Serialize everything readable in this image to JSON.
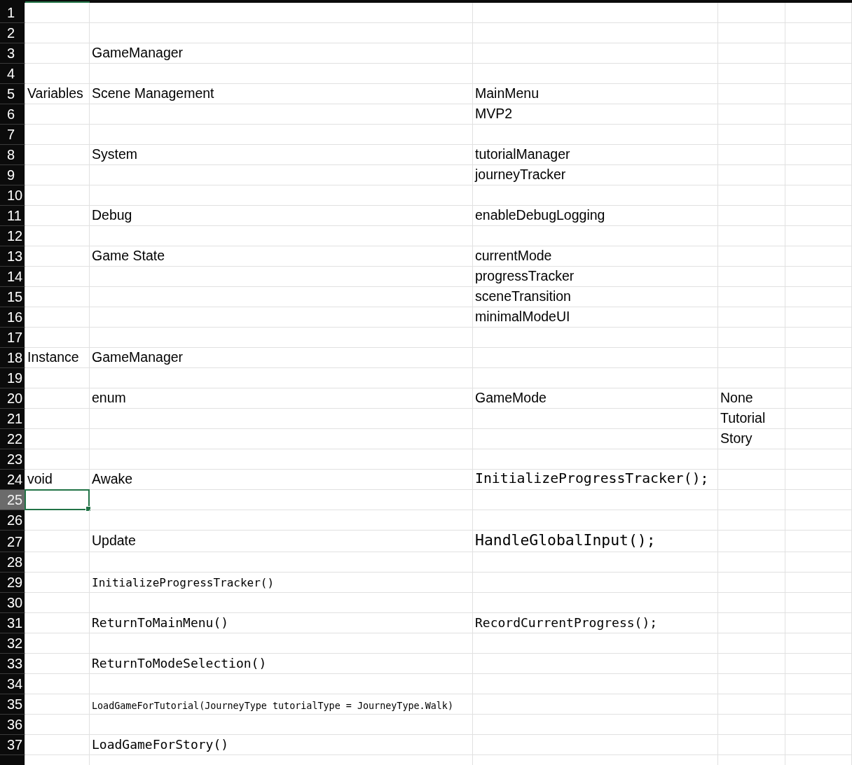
{
  "rows": [
    {
      "number": "1",
      "selected": false,
      "cells": [
        null,
        null,
        null,
        null,
        null
      ]
    },
    {
      "number": "2",
      "selected": false,
      "cells": [
        null,
        null,
        null,
        null,
        null
      ]
    },
    {
      "number": "3",
      "selected": false,
      "cells": [
        null,
        {
          "text": "GameManager",
          "kind": "text"
        },
        null,
        null,
        null
      ]
    },
    {
      "number": "4",
      "selected": false,
      "cells": [
        null,
        null,
        null,
        null,
        null
      ]
    },
    {
      "number": "5",
      "selected": false,
      "cells": [
        {
          "text": "Variables",
          "kind": "text"
        },
        {
          "text": "Scene Management",
          "kind": "text"
        },
        {
          "text": "MainMenu",
          "kind": "text"
        },
        null,
        null
      ]
    },
    {
      "number": "6",
      "selected": false,
      "cells": [
        null,
        null,
        {
          "text": "MVP2",
          "kind": "text"
        },
        null,
        null
      ]
    },
    {
      "number": "7",
      "selected": false,
      "cells": [
        null,
        null,
        null,
        null,
        null
      ]
    },
    {
      "number": "8",
      "selected": false,
      "cells": [
        null,
        {
          "text": "System",
          "kind": "text"
        },
        {
          "text": "tutorialManager",
          "kind": "text"
        },
        null,
        null
      ]
    },
    {
      "number": "9",
      "selected": false,
      "cells": [
        null,
        null,
        {
          "text": "journeyTracker",
          "kind": "text"
        },
        null,
        null
      ]
    },
    {
      "number": "10",
      "selected": false,
      "cells": [
        null,
        null,
        null,
        null,
        null
      ]
    },
    {
      "number": "11",
      "selected": false,
      "cells": [
        null,
        {
          "text": "Debug",
          "kind": "text"
        },
        {
          "text": "enableDebugLogging",
          "kind": "text"
        },
        null,
        null
      ]
    },
    {
      "number": "12",
      "selected": false,
      "cells": [
        null,
        null,
        null,
        null,
        null
      ]
    },
    {
      "number": "13",
      "selected": false,
      "cells": [
        null,
        {
          "text": "Game State",
          "kind": "text"
        },
        {
          "text": "currentMode",
          "kind": "text"
        },
        null,
        null
      ]
    },
    {
      "number": "14",
      "selected": false,
      "cells": [
        null,
        null,
        {
          "text": "progressTracker",
          "kind": "text"
        },
        null,
        null
      ]
    },
    {
      "number": "15",
      "selected": false,
      "cells": [
        null,
        null,
        {
          "text": "sceneTransition",
          "kind": "text"
        },
        null,
        null
      ]
    },
    {
      "number": "16",
      "selected": false,
      "cells": [
        null,
        null,
        {
          "text": "minimalModeUI",
          "kind": "text"
        },
        null,
        null
      ]
    },
    {
      "number": "17",
      "selected": false,
      "cells": [
        null,
        null,
        null,
        null,
        null
      ]
    },
    {
      "number": "18",
      "selected": false,
      "cells": [
        {
          "text": "Instance",
          "kind": "text"
        },
        {
          "text": "GameManager",
          "kind": "text"
        },
        null,
        null,
        null
      ]
    },
    {
      "number": "19",
      "selected": false,
      "cells": [
        null,
        null,
        null,
        null,
        null
      ]
    },
    {
      "number": "20",
      "selected": false,
      "cells": [
        null,
        {
          "text": "enum",
          "kind": "text"
        },
        {
          "text": "GameMode",
          "kind": "text"
        },
        {
          "text": "None",
          "kind": "text"
        },
        null
      ]
    },
    {
      "number": "21",
      "selected": false,
      "cells": [
        null,
        null,
        null,
        {
          "text": "Tutorial",
          "kind": "text"
        },
        null
      ]
    },
    {
      "number": "22",
      "selected": false,
      "cells": [
        null,
        null,
        null,
        {
          "text": "Story",
          "kind": "text"
        },
        null
      ]
    },
    {
      "number": "23",
      "selected": false,
      "cells": [
        null,
        null,
        null,
        null,
        null
      ]
    },
    {
      "number": "24",
      "selected": false,
      "cells": [
        {
          "text": "void",
          "kind": "text"
        },
        {
          "text": "Awake",
          "kind": "text"
        },
        {
          "text": "InitializeProgressTracker();",
          "kind": "code-large"
        },
        null,
        null
      ]
    },
    {
      "number": "25",
      "selected": true,
      "cells": [
        {
          "selected": true
        },
        null,
        null,
        null,
        null
      ]
    },
    {
      "number": "26",
      "selected": false,
      "cells": [
        null,
        null,
        null,
        null,
        null
      ]
    },
    {
      "number": "27",
      "selected": false,
      "cells": [
        null,
        {
          "text": "Update",
          "kind": "text"
        },
        {
          "text": "HandleGlobalInput();",
          "kind": "code-huge"
        },
        null,
        null
      ]
    },
    {
      "number": "28",
      "selected": false,
      "cells": [
        null,
        null,
        null,
        null,
        null
      ]
    },
    {
      "number": "29",
      "selected": false,
      "cells": [
        null,
        {
          "text": "InitializeProgressTracker()",
          "kind": "code-small"
        },
        null,
        null,
        null
      ]
    },
    {
      "number": "30",
      "selected": false,
      "cells": [
        null,
        null,
        null,
        null,
        null
      ]
    },
    {
      "number": "31",
      "selected": false,
      "cells": [
        null,
        {
          "text": "ReturnToMainMenu()",
          "kind": "code"
        },
        {
          "text": "RecordCurrentProgress();",
          "kind": "code"
        },
        null,
        null
      ]
    },
    {
      "number": "32",
      "selected": false,
      "cells": [
        null,
        null,
        null,
        null,
        null
      ]
    },
    {
      "number": "33",
      "selected": false,
      "cells": [
        null,
        {
          "text": "ReturnToModeSelection()",
          "kind": "code"
        },
        null,
        null,
        null
      ]
    },
    {
      "number": "34",
      "selected": false,
      "cells": [
        null,
        null,
        null,
        null,
        null
      ]
    },
    {
      "number": "35",
      "selected": false,
      "cells": [
        null,
        {
          "text": "LoadGameForTutorial(JourneyType tutorialType = JourneyType.Walk)",
          "kind": "code-tiny"
        },
        null,
        null,
        null
      ]
    },
    {
      "number": "36",
      "selected": false,
      "cells": [
        null,
        null,
        null,
        null,
        null
      ]
    },
    {
      "number": "37",
      "selected": false,
      "cells": [
        null,
        {
          "text": "LoadGameForStory()",
          "kind": "code"
        },
        null,
        null,
        null
      ]
    }
  ]
}
